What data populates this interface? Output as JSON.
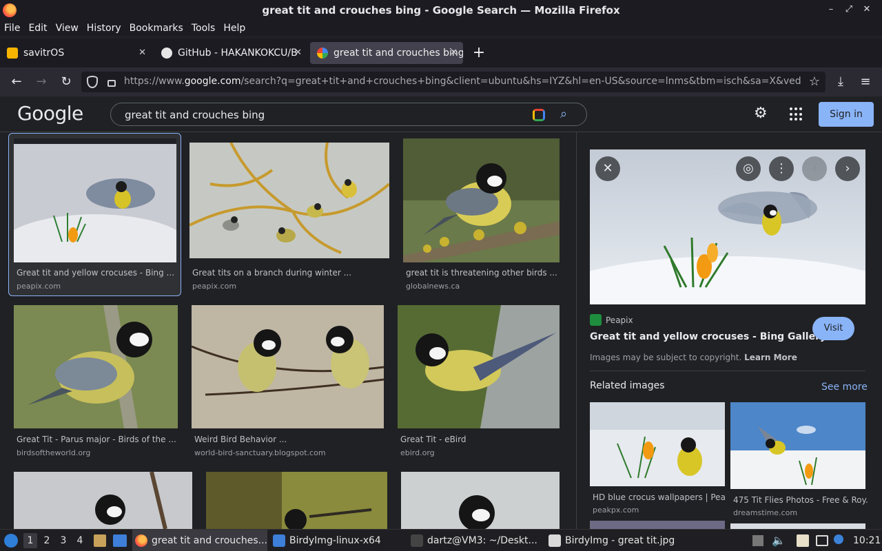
{
  "window": {
    "title": "great tit and crouches bing - Google Search — Mozilla Firefox",
    "controls": [
      "–",
      "⤢",
      "✕"
    ]
  },
  "menu": [
    "File",
    "Edit",
    "View",
    "History",
    "Bookmarks",
    "Tools",
    "Help"
  ],
  "tabs": [
    {
      "label": "savitrOS",
      "close": "✕"
    },
    {
      "label": "GitHub - HAKANKOKCU/B",
      "close": "✕"
    },
    {
      "label": "great tit and crouches bing",
      "close": "✕"
    }
  ],
  "newtab": "+",
  "url": {
    "pre": "https://www.",
    "domain": "google.com",
    "rest": "/search?q=great+tit+and+crouches+bing&client=ubuntu&hs=IYZ&hl=en-US&source=lnms&tbm=isch&sa=X&ved"
  },
  "google": {
    "logo": "Google",
    "query": "great tit and crouches bing",
    "signin": "Sign in"
  },
  "results": [
    {
      "caption": "Great tit and yellow crocuses - Bing ...",
      "source": "peapix.com"
    },
    {
      "caption": "Great tits on a branch during winter ...",
      "source": "peapix.com"
    },
    {
      "caption": "great tit is threatening other birds ...",
      "source": "globalnews.ca"
    },
    {
      "caption": "Great Tit - Parus major - Birds of the ...",
      "source": "birdsoftheworld.org"
    },
    {
      "caption": "Weird Bird Behavior ...",
      "source": "world-bird-sanctuary.blogspot.com"
    },
    {
      "caption": "Great Tit - eBird",
      "source": "ebird.org"
    }
  ],
  "panel": {
    "source": "Peapix",
    "title": "Great tit and yellow crocuses - Bing Gallery",
    "visit": "Visit",
    "copyright": "Images may be subject to copyright.",
    "learn_more": "Learn More",
    "related": "Related images",
    "see_more": "See more",
    "related_items": [
      {
        "caption": "HD blue crocus wallpapers | Pea...",
        "source": "peakpx.com"
      },
      {
        "caption": "475 Tit Flies Photos - Free & Roy...",
        "source": "dreamstime.com"
      }
    ]
  },
  "taskbar": {
    "workspaces": [
      "1",
      "2",
      "3",
      "4"
    ],
    "tasks": [
      "great tit and crouches...",
      "BirdyImg-linux-x64",
      "dartz@VM3: ~/Deskt...",
      "BirdyImg - great tit.jpg"
    ],
    "clock": "10:21"
  }
}
